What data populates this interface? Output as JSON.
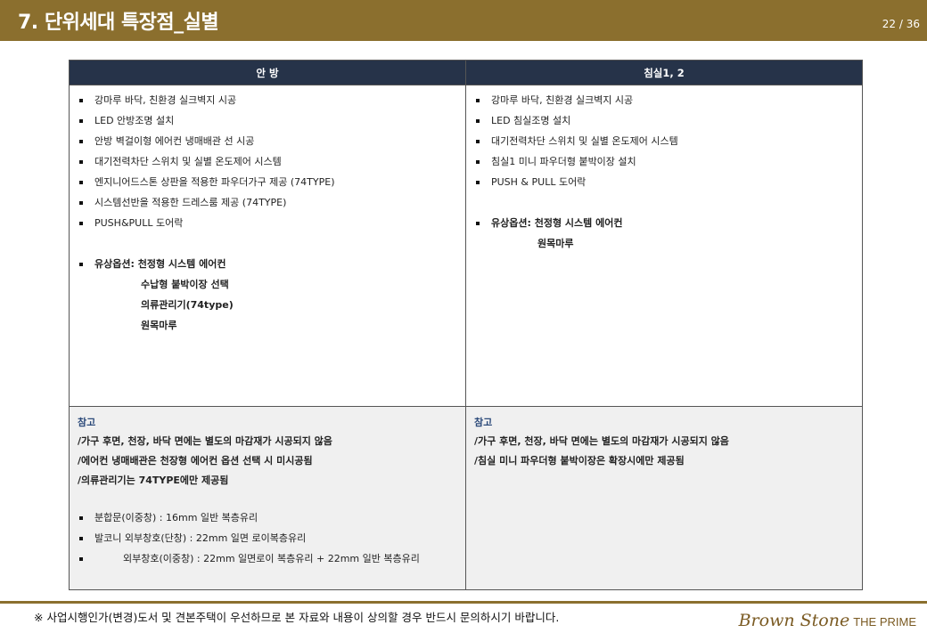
{
  "header": {
    "title": "7. 단위세대 특장점_실별",
    "page": "22  /  36"
  },
  "table": {
    "columns": [
      "안 방",
      "침실1, 2"
    ],
    "left": {
      "items": [
        "강마루 바닥, 친환경 실크벽지 시공",
        "LED 안방조명 설치",
        "안방 벽걸이형 에어컨 냉매배관 선 시공",
        "대기전력차단 스위치 및 실별 온도제어 시스템",
        "엔지니어드스톤 상판을 적용한 파우더가구 제공 (74TYPE)",
        "시스템선반을 적용한 드레스룸 제공 (74TYPE)",
        "PUSH&PULL 도어락"
      ],
      "option_label": "유상옵션: 천정형 시스템 에어컨",
      "option_subs": [
        "수납형 붙박이장 선택",
        "의류관리기(74type)",
        "원목마루"
      ]
    },
    "right": {
      "items": [
        "강마루 바닥, 친환경 실크벽지 시공",
        "LED 침실조명 설치",
        "대기전력차단 스위치 및 실별 온도제어 시스템",
        "침실1 미니 파우더형 붙박이장 설치",
        "PUSH & PULL 도어락"
      ],
      "option_label": "유상옵션: 천정형 시스템 에어컨",
      "option_subs": [
        "원목마루"
      ]
    },
    "notes": {
      "left": {
        "title": "참고",
        "lines": [
          "/가구 후면, 천장, 바닥 면에는 별도의 마감재가 시공되지 않음",
          "/에어컨 냉매배관은 천장형 에어컨 옵션 선택 시 미시공됨",
          "/의류관리기는 74TYPE에만 제공됨"
        ],
        "items": [
          "분합문(이중창) : 16mm 일반 복층유리",
          "발코니 외부창호(단창) : 22mm 일면 로이복층유리",
          "외부창호(이중창) : 22mm 일면로이 복층유리 + 22mm 일반 복층유리"
        ]
      },
      "right": {
        "title": "참고",
        "lines": [
          "/가구 후면, 천장, 바닥 면에는 별도의 마감재가 시공되지 않음",
          "/침실 미니 파우더형 붙박이장은 확장시에만 제공됨"
        ]
      }
    }
  },
  "footer": {
    "note": "※ 사업시행인가(변경)도서 및 견본주택이 우선하므로 본 자료와 내용이 상의할 경우 반드시 문의하시기 바랍니다.",
    "brand_main": "Brown Stone",
    "brand_sub": "THE PRIME"
  }
}
